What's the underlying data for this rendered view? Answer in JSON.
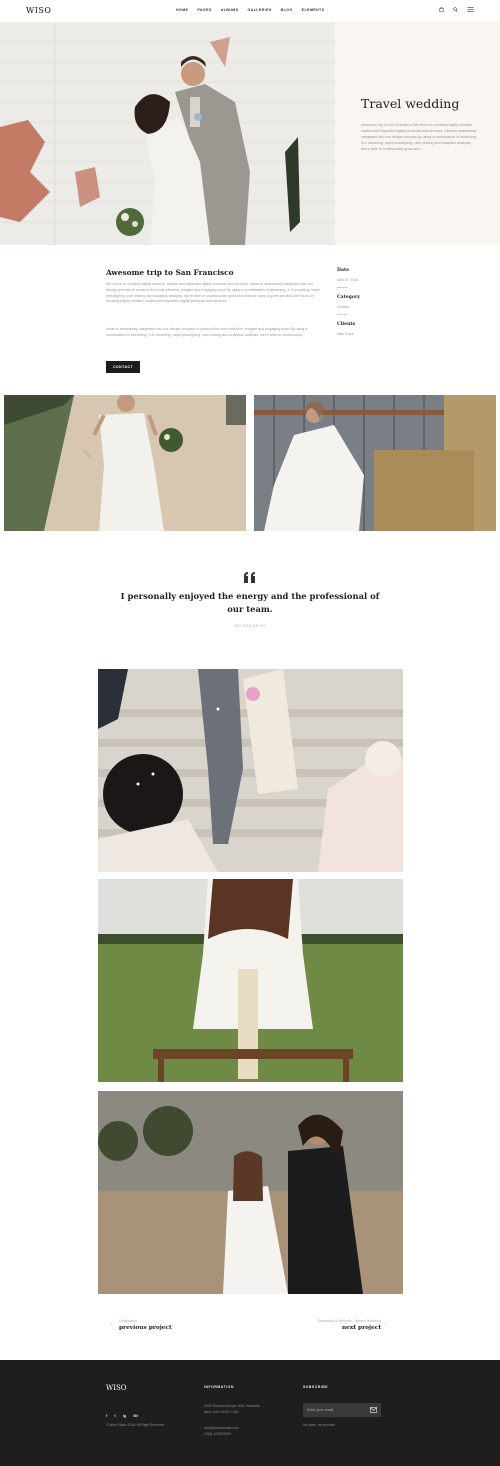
{
  "header": {
    "logo": "WISO",
    "nav": [
      "HOME",
      "PAGES",
      "ALBUMS",
      "GALLERIES",
      "BLOG",
      "ELEMENTS"
    ],
    "icons": [
      "bag-icon",
      "search-icon",
      "menu-icon"
    ]
  },
  "hero": {
    "title": "Travel wedding",
    "text": "Awesome trip to San Francisco We focus on creating highly intuitive, usable and impactful digital products and services. Ideas is seamlessly integrated into our design process by using a combination of sketching, 3-D modeling, rapid prototyping, user testing and analytics analysis, we're able to continuously grow and ..."
  },
  "project": {
    "title": "Awesome trip to San Francisco",
    "p1": "We focus on creating highly intuitive, usable and impactful digital products and services. Ideas is seamlessly integrated into our design process to produce the most effective, elegant and engaging work By using a combination of sketching, 3-D modeling, rapid prototyping, user testing and analytics analysis, we're able to continuously grow and improve upon a given product.We focus on creating highly intuitive, usable and impactful digital products and services.",
    "p2": "Ideas is seamlessly integrated into our design process to produce the most effective, elegant and engaging work By using a combination of sketching, 3-D modeling, rapid prototyping, user testing and analytics analysis, we're able to continuously",
    "contact_label": "CONTACT",
    "meta": [
      {
        "label": "Date",
        "value": "April 29, 2016"
      },
      {
        "label": "Category",
        "value": "Creative"
      },
      {
        "label": "Clients",
        "value": "Mike Force"
      }
    ]
  },
  "quote": {
    "text": "I personally enjoyed the energy and the professional of our team.",
    "author": "MELISSA SMITH"
  },
  "pagination": {
    "prev_small": "Destination",
    "prev_label": "previous project",
    "next_small": "Samantha & Michelle – Beach Wedding",
    "next_label": "next project"
  },
  "footer": {
    "logo": "WISO",
    "social": [
      "f",
      "t",
      "ig",
      "Bē"
    ],
    "copyright": "© Wiso Studio 2016. All Right Reserved.",
    "info_head": "INFORMATION",
    "address1": "2005 Stokes Isle Apt. 896, Venaville,",
    "address2": "New York 10010, USA",
    "email": "info@yourdomain.com",
    "phone": "(+68) 120034509",
    "subscribe_head": "SUBSCRIBE",
    "email_placeholder": "Enter your email",
    "no_spam": "No spam, we promise"
  }
}
